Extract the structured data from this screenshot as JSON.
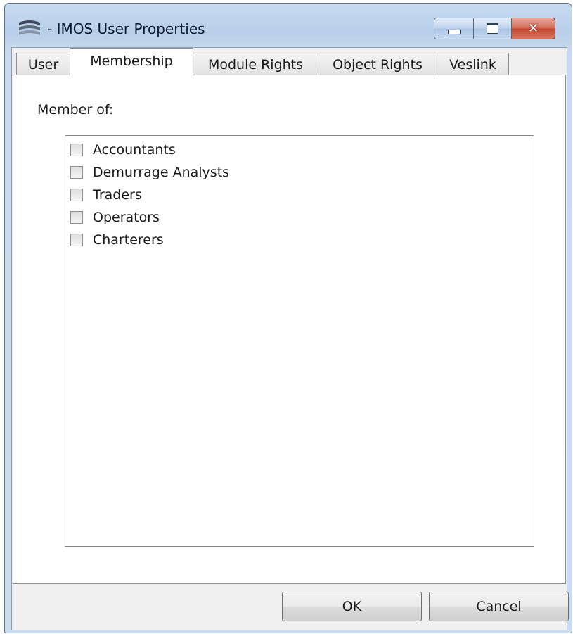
{
  "window": {
    "title": "- IMOS User Properties",
    "logo_icon": "imos-logo-icon",
    "caption_buttons": {
      "minimize": "minimize-icon",
      "maximize": "maximize-icon",
      "close": "close-icon"
    }
  },
  "tabs": [
    {
      "label": "User",
      "active": false
    },
    {
      "label": "Membership",
      "active": true
    },
    {
      "label": "Module Rights",
      "active": false
    },
    {
      "label": "Object Rights",
      "active": false
    },
    {
      "label": "Veslink",
      "active": false
    }
  ],
  "membership": {
    "label": "Member of:",
    "groups": [
      {
        "label": "Accountants",
        "checked": false
      },
      {
        "label": "Demurrage Analysts",
        "checked": false
      },
      {
        "label": "Traders",
        "checked": false
      },
      {
        "label": "Operators",
        "checked": false
      },
      {
        "label": "Charterers",
        "checked": false
      }
    ]
  },
  "buttons": {
    "ok": "OK",
    "cancel": "Cancel"
  }
}
